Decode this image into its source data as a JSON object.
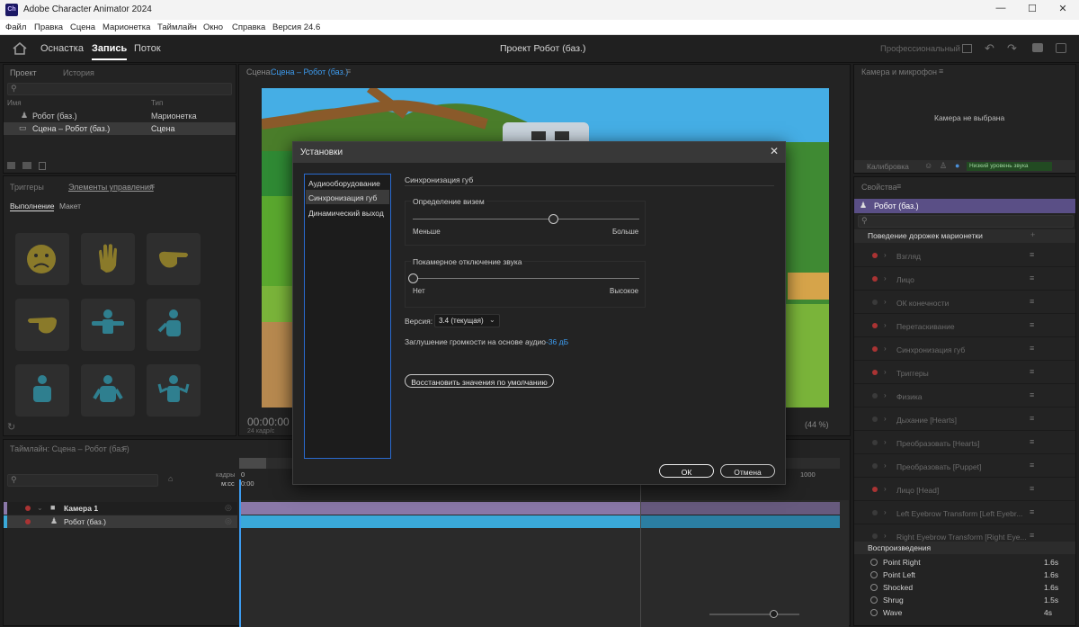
{
  "titlebar": {
    "logo": "Ch",
    "title": "Adobe Character Animator 2024",
    "minimize": "—",
    "maximize": "☐",
    "close": "✕"
  },
  "menu": [
    "Файл",
    "Правка",
    "Сцена",
    "Марионетка",
    "Таймлайн",
    "Окно",
    "Справка",
    "Версия 24.6"
  ],
  "appbar": {
    "tabs": [
      "Оснастка",
      "Запись",
      "Поток"
    ],
    "active_tab": "Запись",
    "project_title": "Проект Робот (баз.)",
    "mode_label": "Профессиональный"
  },
  "project_panel": {
    "tabs": [
      "Проект",
      "История"
    ],
    "col_name": "Имя",
    "col_type": "Тип",
    "rows": [
      {
        "name": "Робот (баз.)",
        "type": "Марионетка"
      },
      {
        "name": "Сцена – Робот (баз.)",
        "type": "Сцена"
      }
    ]
  },
  "controls_panel": {
    "tabs": [
      "Триггеры",
      "Элементы управления"
    ],
    "subtabs": [
      "Выполнение",
      "Макет"
    ]
  },
  "scene_panel": {
    "label": "Сцена:",
    "scene_name": "Сцена – Робот (баз.)",
    "timecode": "00:00:00",
    "fps": "24 кадр/с",
    "zoom": "(44 %)"
  },
  "camera_panel": {
    "title": "Камера и микрофон",
    "no_camera": "Камера не выбрана",
    "calibrate": "Калибровка",
    "audio_level": "Низкий уровень звука"
  },
  "properties_panel": {
    "title": "Свойства",
    "puppet": "Робот (баз.)",
    "section": "Поведение дорожек марионетки",
    "behaviors": [
      {
        "label": "Взгляд",
        "armed": true
      },
      {
        "label": "Лицо",
        "armed": true
      },
      {
        "label": "ОК конечности",
        "armed": false
      },
      {
        "label": "Перетаскивание",
        "armed": true
      },
      {
        "label": "Синхронизация губ",
        "armed": true
      },
      {
        "label": "Триггеры",
        "armed": true
      },
      {
        "label": "Физика",
        "armed": false
      },
      {
        "label": "Дыхание [Hearts]",
        "armed": false
      },
      {
        "label": "Преобразовать [Hearts]",
        "armed": false
      },
      {
        "label": "Преобразовать [Puppet]",
        "armed": false
      },
      {
        "label": "Лицо [Head]",
        "armed": true
      },
      {
        "label": "Left Eyebrow Transform [Left Eyebr...",
        "armed": false
      },
      {
        "label": "Right Eyebrow Transform [Right Eye...",
        "armed": false
      }
    ],
    "playback_title": "Воспроизведения",
    "playback": [
      {
        "label": "Point Right",
        "dur": "1.6s"
      },
      {
        "label": "Point Left",
        "dur": "1.6s"
      },
      {
        "label": "Shocked",
        "dur": "1.6s"
      },
      {
        "label": "Shrug",
        "dur": "1.5s"
      },
      {
        "label": "Wave",
        "dur": "4s"
      }
    ]
  },
  "timeline": {
    "title": "Таймлайн: Сцена – Робот (баз.)",
    "frames_label": "кадры",
    "mss_label": "м:сс",
    "frame_zero": "0",
    "time_zero": "0:00",
    "frame_end": "1000",
    "tracks": [
      {
        "name": "Камера 1"
      },
      {
        "name": "Робот (баз.)"
      }
    ]
  },
  "dialog": {
    "title": "Установки",
    "nav": [
      "Аудиооборудование",
      "Синхронизация губ",
      "Динамический выход"
    ],
    "active_nav": "Синхронизация губ",
    "section_title": "Синхронизация губ",
    "group1": {
      "title": "Определение визем",
      "min": "Меньше",
      "max": "Больше",
      "value": 0.62
    },
    "group2": {
      "title": "Покамерное отключение звука",
      "min": "Нет",
      "max": "Высокое",
      "value": 0.0
    },
    "version_label": "Версия:",
    "version_value": "3.4 (текущая)",
    "ducking_label": "Заглушение громкости на основе аудио",
    "ducking_value": "-36 дБ",
    "restore": "Восстановить значения по умолчанию",
    "ok": "ОК",
    "cancel": "Отмена"
  },
  "colors": {
    "accent_blue": "#3d9cf0",
    "puppet_purple": "#5a4f86",
    "track_purple": "#8a78a8",
    "track_blue": "#3aa9d9",
    "record_red": "#a33"
  }
}
